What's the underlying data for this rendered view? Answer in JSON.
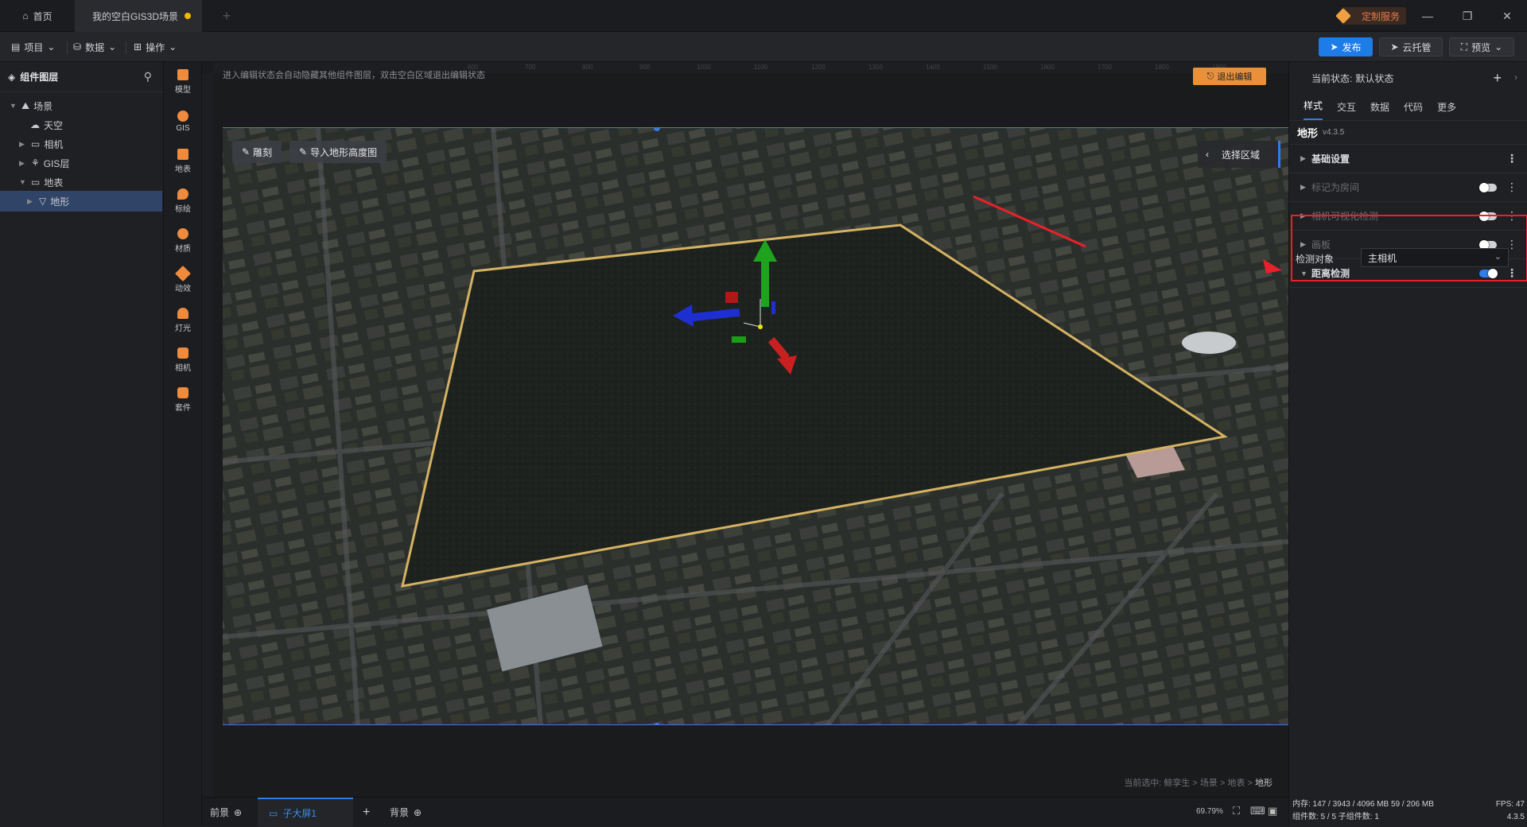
{
  "tabs": {
    "home": "首页",
    "scene": "我的空白GIS3D场景"
  },
  "header": {
    "custom_service": "定制服务"
  },
  "toolbar": {
    "project": "项目",
    "data": "数据",
    "operate": "操作",
    "publish": "发布",
    "cloud": "云托管",
    "preview": "预览"
  },
  "layers": {
    "title": "组件图层",
    "items": [
      {
        "label": "场景",
        "icon": "scene-icon"
      },
      {
        "label": "天空",
        "icon": "sky-icon"
      },
      {
        "label": "相机",
        "icon": "folder-icon"
      },
      {
        "label": "GIS层",
        "icon": "gis-icon"
      },
      {
        "label": "地表",
        "icon": "folder-icon"
      },
      {
        "label": "地形",
        "icon": "terrain-icon"
      }
    ]
  },
  "rail": [
    {
      "label": "模型",
      "color": "#f08a3c"
    },
    {
      "label": "GIS",
      "color": "#f08a3c"
    },
    {
      "label": "地表",
      "color": "#f08a3c"
    },
    {
      "label": "标绘",
      "color": "#f08a3c"
    },
    {
      "label": "材质",
      "color": "#f08a3c"
    },
    {
      "label": "动效",
      "color": "#f08a3c"
    },
    {
      "label": "灯光",
      "color": "#f08a3c"
    },
    {
      "label": "相机",
      "color": "#f08a3c"
    },
    {
      "label": "套件",
      "color": "#f08a3c"
    }
  ],
  "canvas": {
    "hint": "进入编辑状态会自动隐藏其他组件图层，双击空白区域退出编辑状态",
    "exit_edit": "退出编辑",
    "sculpt": "雕刻",
    "import_height": "导入地形高度图",
    "select_area": "选择区域",
    "breadcrumb_prefix": "当前选中: 鲸孪生 > 场景 > 地表 >",
    "breadcrumb_current": "地形",
    "ruler_ticks": [
      "600",
      "700",
      "800",
      "900",
      "1000",
      "1100",
      "1200",
      "1300",
      "1400",
      "1500",
      "1600",
      "1700",
      "1800",
      "1900"
    ]
  },
  "pages": {
    "front": "前景",
    "child": "子大屏1",
    "back": "背景",
    "zoom": "69.79%"
  },
  "right": {
    "state_label": "当前状态:",
    "state_value": "默认状态",
    "tabs": [
      "样式",
      "交互",
      "数据",
      "代码",
      "更多"
    ],
    "component": "地形",
    "version": "v4.3.5",
    "sections": [
      {
        "label": "基础设置",
        "toggle": null,
        "dim": false
      },
      {
        "label": "标记为房间",
        "toggle": false,
        "dim": true
      },
      {
        "label": "相机可视化检测",
        "toggle": false,
        "dim": true
      },
      {
        "label": "画板",
        "toggle": false,
        "dim": true
      },
      {
        "label": "距离检测",
        "toggle": true,
        "dim": false
      }
    ],
    "detect_label": "检测对象",
    "detect_value": "主相机"
  },
  "stats": {
    "memory": "内存: 147 / 3943 / 4096 MB  59 / 206 MB",
    "fps": "FPS: 47",
    "components": "组件数: 5 / 5   子组件数: 1",
    "version": "4.3.5"
  },
  "colors": {
    "accent": "#2f7ee8",
    "warning": "#e8903a",
    "highlight": "#e8202a"
  }
}
